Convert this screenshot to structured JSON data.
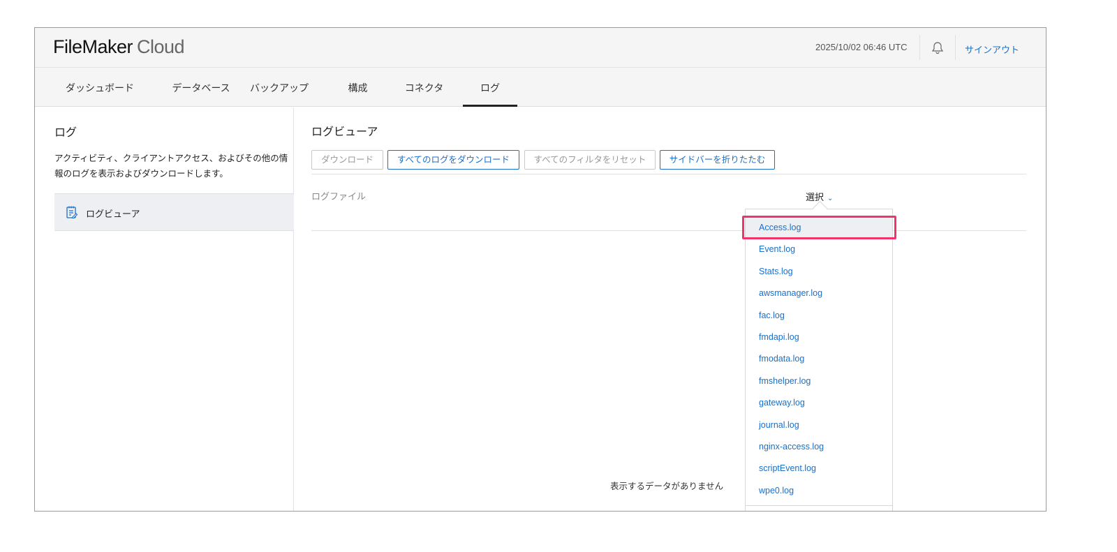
{
  "header": {
    "logo_main": "FileMaker",
    "logo_sub": "Cloud",
    "datetime": "2025/10/02 06:46 UTC",
    "signout": "サインアウト"
  },
  "nav": {
    "tabs": [
      {
        "label": "ダッシュボード"
      },
      {
        "label": "データベース"
      },
      {
        "label": "バックアップ"
      },
      {
        "label": "構成"
      },
      {
        "label": "コネクタ"
      },
      {
        "label": "ログ",
        "active": true
      }
    ]
  },
  "sidebar": {
    "title": "ログ",
    "description": "アクティビティ、クライアントアクセス、およびその他の情報のログを表示およびダウンロードします。",
    "items": [
      {
        "label": "ログビューア",
        "icon": "notepad-icon"
      }
    ]
  },
  "main": {
    "title": "ログビューア",
    "buttons": {
      "download": "ダウンロード",
      "download_all": "すべてのログをダウンロード",
      "reset_filters": "すべてのフィルタをリセット",
      "collapse_sidebar": "サイドバーを折りたたむ"
    },
    "log_file_label": "ログファイル",
    "select_label": "選択",
    "empty_message": "表示するデータがありません"
  },
  "dropdown": {
    "options": [
      "Access.log",
      "Event.log",
      "Stats.log",
      "awsmanager.log",
      "fac.log",
      "fmdapi.log",
      "fmodata.log",
      "fmshelper.log",
      "gateway.log",
      "journal.log",
      "nginx-access.log",
      "scriptEvent.log",
      "wpe0.log"
    ],
    "highlighted": "Access.log"
  },
  "colors": {
    "accent": "#1a6fc9",
    "highlight_border": "#f0336b"
  }
}
